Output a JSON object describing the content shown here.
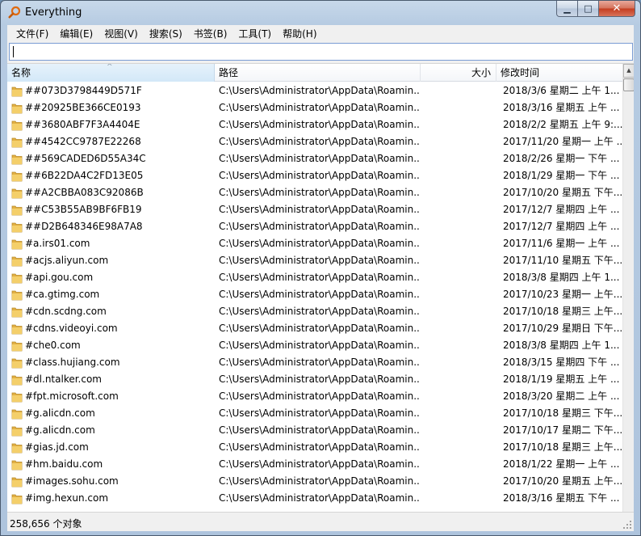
{
  "window": {
    "title": "Everything"
  },
  "menu": [
    "文件(F)",
    "编辑(E)",
    "视图(V)",
    "搜索(S)",
    "书签(B)",
    "工具(T)",
    "帮助(H)"
  ],
  "search": {
    "value": ""
  },
  "columns": {
    "name": "名称",
    "path": "路径",
    "size": "大小",
    "modified": "修改时间"
  },
  "rows": [
    {
      "name": "##073D3798449D571F",
      "path": "C:\\Users\\Administrator\\AppData\\Roamin...",
      "modified": "2018/3/6 星期二 上午 1..."
    },
    {
      "name": "##20925BE366CE0193",
      "path": "C:\\Users\\Administrator\\AppData\\Roamin...",
      "modified": "2018/3/16 星期五 上午 ..."
    },
    {
      "name": "##3680ABF7F3A4404E",
      "path": "C:\\Users\\Administrator\\AppData\\Roamin...",
      "modified": "2018/2/2 星期五 上午 9:..."
    },
    {
      "name": "##4542CC9787E22268",
      "path": "C:\\Users\\Administrator\\AppData\\Roamin...",
      "modified": "2017/11/20 星期一 上午 ..."
    },
    {
      "name": "##569CADED6D55A34C",
      "path": "C:\\Users\\Administrator\\AppData\\Roamin...",
      "modified": "2018/2/26 星期一 下午 ..."
    },
    {
      "name": "##6B22DA4C2FD13E05",
      "path": "C:\\Users\\Administrator\\AppData\\Roamin...",
      "modified": "2018/1/29 星期一 下午 ..."
    },
    {
      "name": "##A2CBBA083C92086B",
      "path": "C:\\Users\\Administrator\\AppData\\Roamin...",
      "modified": "2017/10/20 星期五 下午..."
    },
    {
      "name": "##C53B55AB9BF6FB19",
      "path": "C:\\Users\\Administrator\\AppData\\Roamin...",
      "modified": "2017/12/7 星期四 上午 ..."
    },
    {
      "name": "##D2B648346E98A7A8",
      "path": "C:\\Users\\Administrator\\AppData\\Roamin...",
      "modified": "2017/12/7 星期四 上午 ..."
    },
    {
      "name": "#a.irs01.com",
      "path": "C:\\Users\\Administrator\\AppData\\Roamin...",
      "modified": "2017/11/6 星期一 上午 ..."
    },
    {
      "name": "#acjs.aliyun.com",
      "path": "C:\\Users\\Administrator\\AppData\\Roamin...",
      "modified": "2017/11/10 星期五 下午..."
    },
    {
      "name": "#api.gou.com",
      "path": "C:\\Users\\Administrator\\AppData\\Roamin...",
      "modified": "2018/3/8 星期四 上午 1..."
    },
    {
      "name": "#ca.gtimg.com",
      "path": "C:\\Users\\Administrator\\AppData\\Roamin...",
      "modified": "2017/10/23 星期一 上午..."
    },
    {
      "name": "#cdn.scdng.com",
      "path": "C:\\Users\\Administrator\\AppData\\Roamin...",
      "modified": "2017/10/18 星期三 上午..."
    },
    {
      "name": "#cdns.videoyi.com",
      "path": "C:\\Users\\Administrator\\AppData\\Roamin...",
      "modified": "2017/10/29 星期日 下午..."
    },
    {
      "name": "#che0.com",
      "path": "C:\\Users\\Administrator\\AppData\\Roamin...",
      "modified": "2018/3/8 星期四 上午 1..."
    },
    {
      "name": "#class.hujiang.com",
      "path": "C:\\Users\\Administrator\\AppData\\Roamin...",
      "modified": "2018/3/15 星期四 下午 ..."
    },
    {
      "name": "#dl.ntalker.com",
      "path": "C:\\Users\\Administrator\\AppData\\Roamin...",
      "modified": "2018/1/19 星期五 上午 ..."
    },
    {
      "name": "#fpt.microsoft.com",
      "path": "C:\\Users\\Administrator\\AppData\\Roamin...",
      "modified": "2018/3/20 星期二 上午 ..."
    },
    {
      "name": "#g.alicdn.com",
      "path": "C:\\Users\\Administrator\\AppData\\Roamin...",
      "modified": "2017/10/18 星期三 下午..."
    },
    {
      "name": "#g.alicdn.com",
      "path": "C:\\Users\\Administrator\\AppData\\Roamin...",
      "modified": "2017/10/17 星期二 下午..."
    },
    {
      "name": "#gias.jd.com",
      "path": "C:\\Users\\Administrator\\AppData\\Roamin...",
      "modified": "2017/10/18 星期三 上午..."
    },
    {
      "name": "#hm.baidu.com",
      "path": "C:\\Users\\Administrator\\AppData\\Roamin...",
      "modified": "2018/1/22 星期一 上午 ..."
    },
    {
      "name": "#images.sohu.com",
      "path": "C:\\Users\\Administrator\\AppData\\Roamin...",
      "modified": "2017/10/20 星期五 上午..."
    },
    {
      "name": "#img.hexun.com",
      "path": "C:\\Users\\Administrator\\AppData\\Roamin...",
      "modified": "2018/3/16 星期五 下午 ..."
    }
  ],
  "status": {
    "text": "258,656 个对象"
  },
  "colors": {
    "folder": "#e8b84a",
    "header_active": "#d9ecfa",
    "title_bar": "#b9cde3",
    "close_button": "#c9452a"
  },
  "icons": {
    "app": "search-magnifier-icon",
    "folder": "folder-icon"
  }
}
